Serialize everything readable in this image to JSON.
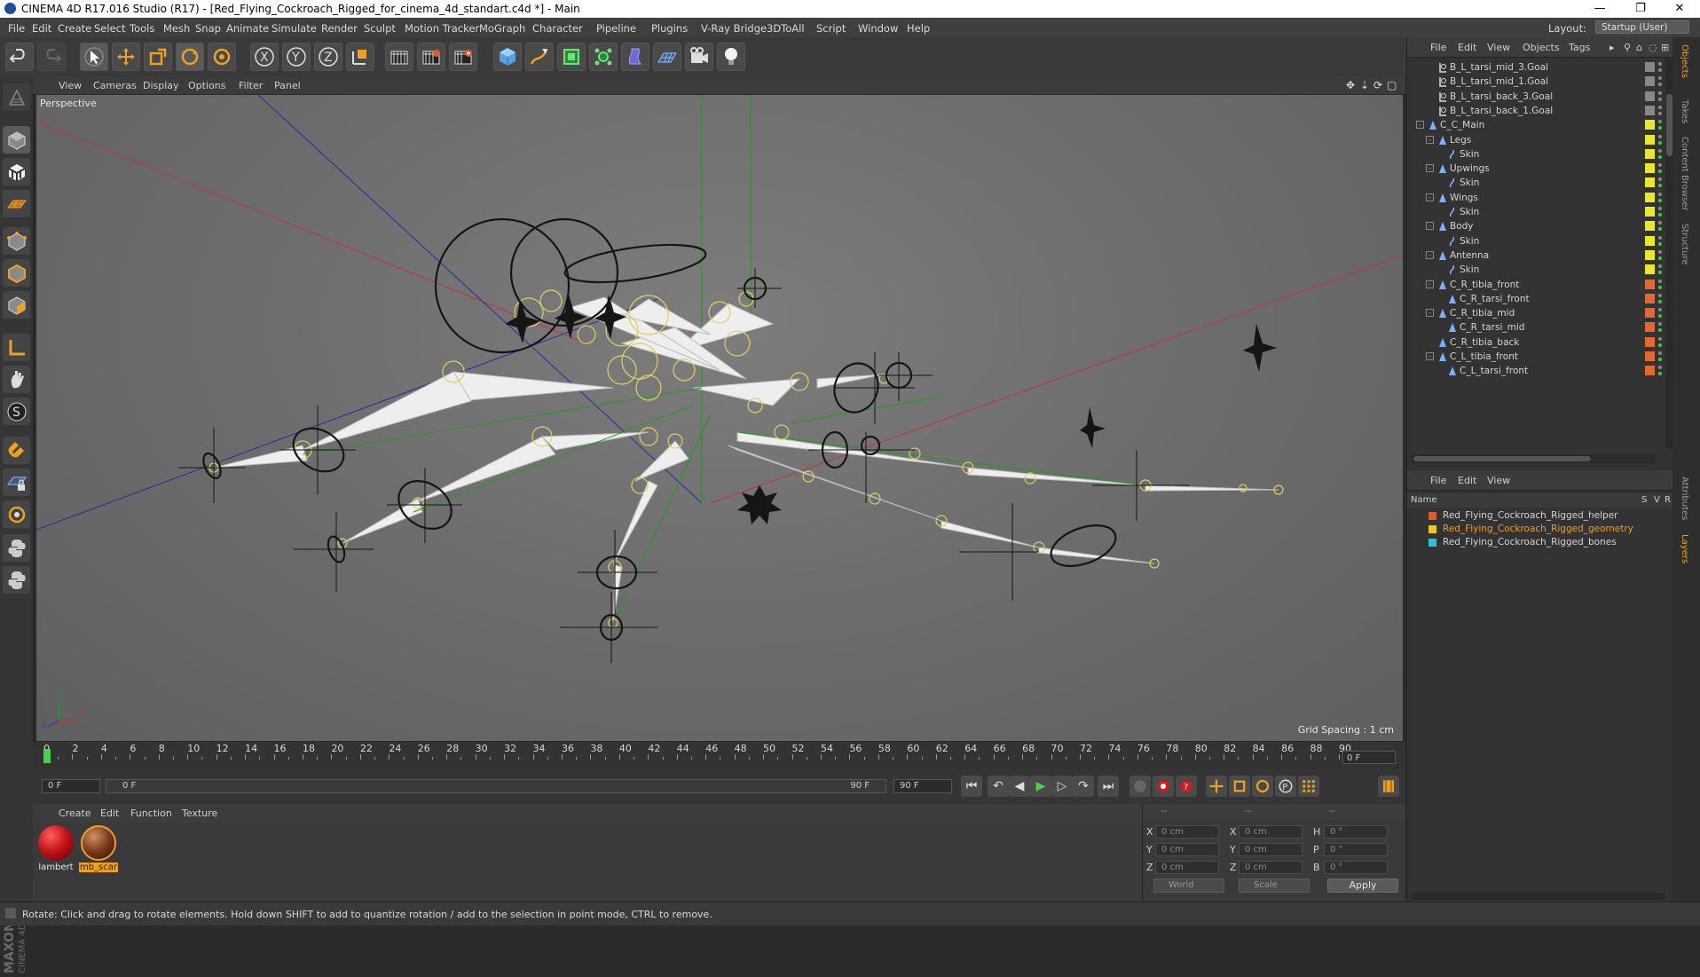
{
  "window": {
    "title": "CINEMA 4D R17.016 Studio (R17) - [Red_Flying_Cockroach_Rigged_for_cinema_4d_standart.c4d *] - Main",
    "controls": {
      "minimize": "—",
      "maximize": "❐",
      "close": "✕"
    }
  },
  "menubar": {
    "items": [
      "File",
      "Edit",
      "Create",
      "Select",
      "Tools",
      "Mesh",
      "Snap",
      "Animate",
      "Simulate",
      "Render",
      "Sculpt",
      "Motion Tracker",
      "MoGraph",
      "Character",
      "Pipeline",
      "Plugins",
      "V-Ray Bridge",
      "3DToAll",
      "Script",
      "Window",
      "Help"
    ],
    "layout_label": "Layout:",
    "layout_value": "Startup (User)"
  },
  "viewport": {
    "menu": [
      "View",
      "Cameras",
      "Display",
      "Options",
      "Filter",
      "Panel"
    ],
    "label": "Perspective",
    "grid_spacing": "Grid Spacing : 1 cm",
    "axis_labels": {
      "x": "x",
      "y": "y",
      "z": "z"
    }
  },
  "timeline": {
    "ticks": [
      "0",
      "2",
      "4",
      "6",
      "8",
      "10",
      "12",
      "14",
      "16",
      "18",
      "20",
      "22",
      "24",
      "26",
      "28",
      "30",
      "32",
      "34",
      "36",
      "38",
      "40",
      "42",
      "44",
      "46",
      "48",
      "50",
      "52",
      "54",
      "56",
      "58",
      "60",
      "62",
      "64",
      "66",
      "68",
      "70",
      "72",
      "74",
      "76",
      "78",
      "80",
      "82",
      "84",
      "86",
      "88",
      "90"
    ],
    "current_frame": "0 F",
    "start_field": "0 F",
    "range_start": "0 F",
    "range_end": "90 F",
    "end_field": "90 F"
  },
  "materials": {
    "menu": [
      "Create",
      "Edit",
      "Function",
      "Texture"
    ],
    "items": [
      {
        "name": "lambert",
        "color": "#c4141a"
      },
      {
        "name": "mb_scar",
        "color": "#7a3a1c"
      }
    ]
  },
  "coordinates": {
    "header": [
      "--",
      "--",
      "--"
    ],
    "rows": [
      {
        "a": "X",
        "a_val": "0 cm",
        "b": "X",
        "b_val": "0 cm",
        "c": "H",
        "c_val": "0 °"
      },
      {
        "a": "Y",
        "a_val": "0 cm",
        "b": "Y",
        "b_val": "0 cm",
        "c": "P",
        "c_val": "0 °"
      },
      {
        "a": "Z",
        "a_val": "0 cm",
        "b": "Z",
        "b_val": "0 cm",
        "c": "B",
        "c_val": "0 °"
      }
    ],
    "world": "World",
    "scale": "Scale",
    "apply": "Apply"
  },
  "objects": {
    "menu": [
      "File",
      "Edit",
      "View",
      "Objects",
      "Tags"
    ],
    "items": [
      {
        "name": "B_L_tarsi_mid_3.Goal",
        "indent": 1,
        "type": "goal",
        "tag": "#888888"
      },
      {
        "name": "B_L_tarsi_mid_1.Goal",
        "indent": 1,
        "type": "goal",
        "tag": "#888888"
      },
      {
        "name": "B_L_tarsi_back_3.Goal",
        "indent": 1,
        "type": "goal",
        "tag": "#888888"
      },
      {
        "name": "B_L_tarsi_back_1.Goal",
        "indent": 1,
        "type": "goal",
        "tag": "#888888"
      },
      {
        "name": "C_C_Main",
        "indent": 0,
        "type": "joint",
        "tag": "#e8e832",
        "expand": "-"
      },
      {
        "name": "Legs",
        "indent": 1,
        "type": "joint",
        "tag": "#e8e832",
        "expand": "-"
      },
      {
        "name": "Skin",
        "indent": 2,
        "type": "skin",
        "tag": "#e8e832"
      },
      {
        "name": "Upwings",
        "indent": 1,
        "type": "joint",
        "tag": "#e8e832",
        "expand": "-"
      },
      {
        "name": "Skin",
        "indent": 2,
        "type": "skin",
        "tag": "#e8e832"
      },
      {
        "name": "Wings",
        "indent": 1,
        "type": "joint",
        "tag": "#e8e832",
        "expand": "-"
      },
      {
        "name": "Skin",
        "indent": 2,
        "type": "skin",
        "tag": "#e8e832"
      },
      {
        "name": "Body",
        "indent": 1,
        "type": "joint",
        "tag": "#e8e832",
        "expand": "-"
      },
      {
        "name": "Skin",
        "indent": 2,
        "type": "skin",
        "tag": "#e8e832"
      },
      {
        "name": "Antenna",
        "indent": 1,
        "type": "joint",
        "tag": "#e8e832",
        "expand": "-"
      },
      {
        "name": "Skin",
        "indent": 2,
        "type": "skin",
        "tag": "#e8e832"
      },
      {
        "name": "C_R_tibia_front",
        "indent": 1,
        "type": "joint",
        "tag": "#e06a32",
        "expand": "-"
      },
      {
        "name": "C_R_tarsi_front",
        "indent": 2,
        "type": "joint",
        "tag": "#e06a32"
      },
      {
        "name": "C_R_tibia_mid",
        "indent": 1,
        "type": "joint",
        "tag": "#e06a32",
        "expand": "-"
      },
      {
        "name": "C_R_tarsi_mid",
        "indent": 2,
        "type": "joint",
        "tag": "#e06a32"
      },
      {
        "name": "C_R_tibia_back",
        "indent": 1,
        "type": "joint",
        "tag": "#e06a32"
      },
      {
        "name": "C_L_tibia_front",
        "indent": 1,
        "type": "joint",
        "tag": "#e06a32",
        "expand": "-"
      },
      {
        "name": "C_L_tarsi_front",
        "indent": 2,
        "type": "joint",
        "tag": "#e06a32"
      }
    ]
  },
  "layers": {
    "menu": [
      "File",
      "Edit",
      "View"
    ],
    "columns": {
      "name": "Name",
      "s": "S",
      "v": "V",
      "r": "R"
    },
    "items": [
      {
        "name": "Red_Flying_Cockroach_Rigged_helper",
        "color": "#e05a2a",
        "text_color": "#d4d4d4"
      },
      {
        "name": "Red_Flying_Cockroach_Rigged_geometry",
        "color": "#e8c832",
        "text_color": "#f0a020"
      },
      {
        "name": "Red_Flying_Cockroach_Rigged_bones",
        "color": "#30c0d8",
        "text_color": "#d4d4d4"
      }
    ]
  },
  "side_tabs": [
    "Objects",
    "Takes",
    "Content Browser",
    "Structure",
    "Attributes",
    "Layers"
  ],
  "status": {
    "text": "Rotate: Click and drag to rotate elements. Hold down SHIFT to add to quantize rotation / add to the selection in point mode, CTRL to remove."
  },
  "colors": {
    "accent_orange": "#f0a020",
    "selection_yellow": "#e8e832",
    "playhead_green": "#4ad04a"
  },
  "icons": {
    "toolbar": [
      "undo-icon",
      "redo-icon",
      "select-icon",
      "move-icon",
      "scale-icon",
      "rotate-icon",
      "recent-rotate-icon",
      "x-axis-icon",
      "y-axis-icon",
      "z-axis-icon",
      "world-coord-icon",
      "render-view-icon",
      "render-picture-icon",
      "render-settings-icon",
      "cube-icon",
      "pen-icon",
      "subdivision-icon",
      "cloner-icon",
      "deformer-icon",
      "floor-icon",
      "camera-icon",
      "light-icon"
    ]
  }
}
